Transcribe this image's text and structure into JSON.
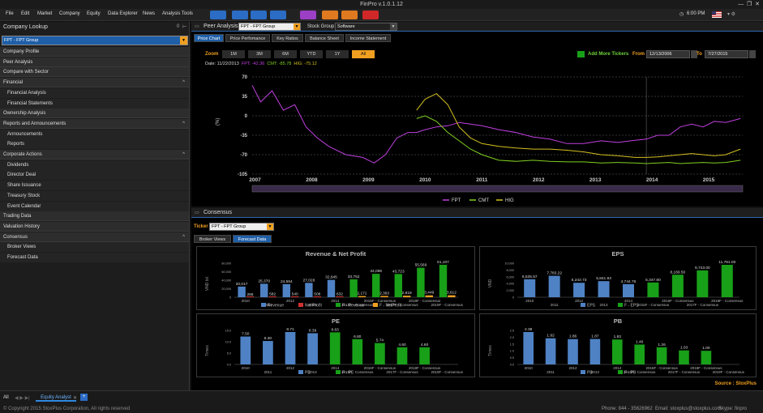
{
  "window": {
    "title": "FinPro v.1.0.1.12"
  },
  "menu": [
    "File",
    "Edit",
    "Market",
    "Company",
    "Equity",
    "Data Explorer",
    "News",
    "Analysis Tools"
  ],
  "toolbar": {
    "colors": [
      "#2b6cc4",
      "#2b6cc4",
      "#2b6cc4",
      "#2b6cc4",
      "#9b3fc4",
      "#e07a20",
      "#e07a20",
      "#d02828"
    ]
  },
  "system": {
    "time": "6:00 PM"
  },
  "sidebar": {
    "title": "Company Lookup",
    "badge": "0",
    "lookup_value": "FPT - FPT Group",
    "items": [
      {
        "label": "Company Profile",
        "type": "sec"
      },
      {
        "label": "Peer Analysis",
        "type": "sec"
      },
      {
        "label": "Compare with Sector",
        "type": "sec"
      },
      {
        "label": "Financial",
        "type": "sec",
        "caret": "^"
      },
      {
        "label": "Financial Analysis",
        "type": "sub"
      },
      {
        "label": "Financial Statements",
        "type": "sub"
      },
      {
        "label": "Ownership Analysis",
        "type": "sec"
      },
      {
        "label": "Reports and Announcements",
        "type": "sec",
        "caret": "^"
      },
      {
        "label": "Announcements",
        "type": "sub"
      },
      {
        "label": "Reports",
        "type": "sub"
      },
      {
        "label": "Corporate Actions",
        "type": "sec",
        "caret": "^"
      },
      {
        "label": "Dividends",
        "type": "sub"
      },
      {
        "label": "Director Deal",
        "type": "sub"
      },
      {
        "label": "Share Issuance",
        "type": "sub"
      },
      {
        "label": "Treasury Stock",
        "type": "sub"
      },
      {
        "label": "Event Calendar",
        "type": "sub"
      },
      {
        "label": "Trading Data",
        "type": "sec"
      },
      {
        "label": "Valuation History",
        "type": "sec"
      },
      {
        "label": "Consensus",
        "type": "sec",
        "caret": "^"
      },
      {
        "label": "Broker Views",
        "type": "sub"
      },
      {
        "label": "Forecast Data",
        "type": "sub"
      }
    ]
  },
  "peer": {
    "title": "Peer Analysis",
    "ticker": "FPT - FPT Group",
    "stock_group_label": "Stock Group",
    "stock_group": "Software",
    "tabs": [
      "Price Chart",
      "Price Perfomance",
      "Key Ratios",
      "Balance Sheet",
      "Income Statement"
    ],
    "zoom_label": "Zoom",
    "zoom": [
      "1M",
      "3M",
      "6M",
      "YTD",
      "1Y",
      "All"
    ],
    "add_more": "Add More Tickers",
    "from_label": "From",
    "from": "12/13/2006",
    "to_label": "To",
    "to": "7/27/2015",
    "readout": {
      "date": "Date: 11/22/2013",
      "fpt": "FPT: -42.36",
      "cmt": "CMT: -85.78",
      "hig": "HIG: -75.12"
    }
  },
  "consensus": {
    "title": "Consensus",
    "ticker_label": "Ticker",
    "ticker": "FPT - FPT Group",
    "tabs": [
      "Broker Views",
      "Forecast Data"
    ],
    "source": "Source : StoxPlus"
  },
  "footer": {
    "all": "All",
    "tab": "Equity Analyst",
    "copyright": "© Copyright 2015 StoxPlus Corporation, All rights reserved",
    "phone": "Phone: 844 - 35626962",
    "email": "Email: stoxplus@stoxplus.com",
    "skype": "Skype: finpro"
  },
  "chart_data": [
    {
      "type": "line",
      "title": "",
      "ylabel": "(%)",
      "ylim": [
        -105,
        70
      ],
      "yticks": [
        70,
        35,
        0,
        -35,
        -70,
        -105
      ],
      "xticks": [
        "2007",
        "2008",
        "2009",
        "2010",
        "2011",
        "2012",
        "2013",
        "2014",
        "2015"
      ],
      "x": [
        2006.95,
        2007.1,
        2007.3,
        2007.5,
        2007.7,
        2007.9,
        2008.1,
        2008.3,
        2008.6,
        2008.9,
        2009.1,
        2009.3,
        2009.5,
        2009.7,
        2009.85,
        2010.0,
        2010.2,
        2010.4,
        2010.6,
        2010.8,
        2011.0,
        2011.3,
        2011.6,
        2011.9,
        2012.2,
        2012.5,
        2012.8,
        2013.1,
        2013.4,
        2013.7,
        2013.9,
        2014.1,
        2014.3,
        2014.5,
        2014.7,
        2014.9,
        2015.1,
        2015.3,
        2015.56
      ],
      "series": [
        {
          "name": "FPT",
          "color": "#c040e0",
          "values": [
            55,
            25,
            45,
            10,
            20,
            -20,
            -40,
            -55,
            -70,
            -75,
            -85,
            -70,
            -40,
            -30,
            -30,
            -25,
            -20,
            -18,
            -12,
            -15,
            -18,
            -25,
            -30,
            -38,
            -42,
            -50,
            -50,
            -45,
            -48,
            -44,
            -42,
            -35,
            -35,
            -20,
            -15,
            -20,
            -10,
            -12,
            -5
          ]
        },
        {
          "name": "CMT",
          "color": "#80d020",
          "values": [
            null,
            null,
            null,
            null,
            null,
            null,
            null,
            null,
            null,
            null,
            null,
            null,
            null,
            null,
            -5,
            0,
            -10,
            -30,
            -45,
            -60,
            -70,
            -80,
            -82,
            -80,
            -82,
            -83,
            -83,
            -85,
            -84,
            -85,
            -86,
            -85,
            -84,
            -86,
            -85,
            -84,
            -85,
            -84,
            -80
          ]
        },
        {
          "name": "HIG",
          "color": "#d4c020",
          "values": [
            null,
            null,
            null,
            null,
            null,
            null,
            null,
            null,
            null,
            null,
            null,
            null,
            null,
            null,
            10,
            30,
            40,
            20,
            -20,
            -40,
            -50,
            -55,
            -58,
            -60,
            -60,
            -62,
            -65,
            -70,
            -72,
            -75,
            -75,
            -74,
            -72,
            -70,
            -68,
            -70,
            -72,
            -70,
            -60
          ]
        }
      ],
      "legend": "bottom-center"
    },
    {
      "type": "bar",
      "title": "Revenue & Net Profit",
      "ylabel": "VND bil.",
      "yticks": [
        "80,000",
        "60,000",
        "40,000",
        "20,000",
        "0"
      ],
      "categories": [
        "2010",
        "2011",
        "2012",
        "2013",
        "2014",
        "2015F - Consensus",
        "2016F - Consensus",
        "2017F - Consensus",
        "2018F - Consensus",
        "2019F - Consensus"
      ],
      "series": [
        {
          "name": "Revenue",
          "color": "#4f82c4",
          "values": [
            20017,
            25370,
            24594,
            27028,
            32645,
            null,
            null,
            null,
            null,
            null
          ]
        },
        {
          "name": "Net Profit",
          "color": "#d03030",
          "values": [
            265,
            582,
            540,
            508,
            632,
            null,
            null,
            null,
            null,
            null
          ]
        },
        {
          "name": "F - Revenue",
          "color": "#18a018",
          "values": [
            null,
            null,
            null,
            null,
            null,
            33752,
            44086,
            43723,
            55569,
            61107
          ]
        },
        {
          "name": "F - NetProfit",
          "color": "#f0a020",
          "values": [
            null,
            null,
            null,
            null,
            null,
            2171,
            2363,
            2818,
            3449,
            3612
          ]
        }
      ],
      "labels_revenue": [
        "20,017",
        "25,370",
        "24,594",
        "27,028",
        "32,645",
        "33,752",
        "44,086",
        "43,723",
        "55,569",
        "61,107"
      ],
      "labels_profit": [
        "265",
        "582",
        "540",
        "508",
        "632",
        "2,171",
        "2,363",
        "2,818",
        "3,449",
        "3,612"
      ],
      "legend": "bottom-center"
    },
    {
      "type": "bar",
      "title": "EPS",
      "ylabel": "VND",
      "yticks": [
        "10,000",
        "8,000",
        "6,000",
        "4,000",
        "2,000",
        "0"
      ],
      "categories": [
        "2010",
        "2011",
        "2012",
        "2013",
        "2014",
        "2015F - Consensus",
        "2016F - Consensus",
        "2017F - Consensus",
        "2018F - Consensus"
      ],
      "series": [
        {
          "name": "EPS",
          "color": "#4f82c4",
          "values": [
            6535.57,
            7783.22,
            5242.73,
            5841.93,
            4744.76,
            null,
            null,
            null,
            null
          ]
        },
        {
          "name": "F - EPS",
          "color": "#18a018",
          "values": [
            null,
            null,
            null,
            null,
            null,
            5347.8,
            8169.5,
            9743,
            11781
          ]
        }
      ],
      "labels": [
        "6,535.57",
        "7,783.22",
        "5,242.73",
        "5,841.93",
        "4,744.76",
        "5,347.80",
        "8,169.50",
        "9,743.00",
        "11,781.00"
      ],
      "legend": "bottom-center"
    },
    {
      "type": "bar",
      "title": "PE",
      "ylabel": "Times",
      "yticks": [
        "15.0",
        "10.0",
        "5.0",
        "0.0"
      ],
      "categories": [
        "2010",
        "2011",
        "2012",
        "2013",
        "2014",
        "2015F - Consensus",
        "2016F - Consensus",
        "2017F - Consensus",
        "2018F - Consensus",
        "2019F - Consensus"
      ],
      "series": [
        {
          "name": "PE",
          "color": "#4f82c4",
          "values": [
            7.5,
            6.3,
            8.71,
            8.39,
            null,
            null,
            null,
            null,
            null,
            null
          ]
        },
        {
          "name": "F - PE",
          "color": "#18a018",
          "values": [
            null,
            null,
            null,
            null,
            8.63,
            6.8,
            5.74,
            4.6,
            4.6,
            null
          ]
        }
      ],
      "labels": [
        "7.50",
        "6.30",
        "8.71",
        "8.39",
        "8.63",
        "6.80",
        "5.74",
        "4.60",
        "4.60"
      ],
      "legend": "bottom-center"
    },
    {
      "type": "bar",
      "title": "PB",
      "ylabel": "Times",
      "yticks": [
        "2.5",
        "2.0",
        "1.5",
        "1.0",
        "0.5",
        "0.0"
      ],
      "categories": [
        "2010",
        "2011",
        "2012",
        "2013",
        "2014",
        "2015F - Consensus",
        "2016F - Consensus",
        "2017F - Consensus",
        "2018F - Consensus",
        "2019F - Consensus"
      ],
      "series": [
        {
          "name": "PB",
          "color": "#4f82c4",
          "values": [
            2.38,
            1.92,
            1.86,
            1.87,
            null,
            null,
            null,
            null,
            null,
            null
          ]
        },
        {
          "name": "F - PB",
          "color": "#18a018",
          "values": [
            null,
            null,
            null,
            null,
            1.83,
            1.46,
            1.26,
            1.03,
            1.0,
            null
          ]
        }
      ],
      "labels": [
        "2.38",
        "1.92",
        "1.86",
        "1.87",
        "1.83",
        "1.46",
        "1.26",
        "1.03",
        "1.00"
      ],
      "legend": "bottom-center"
    }
  ]
}
